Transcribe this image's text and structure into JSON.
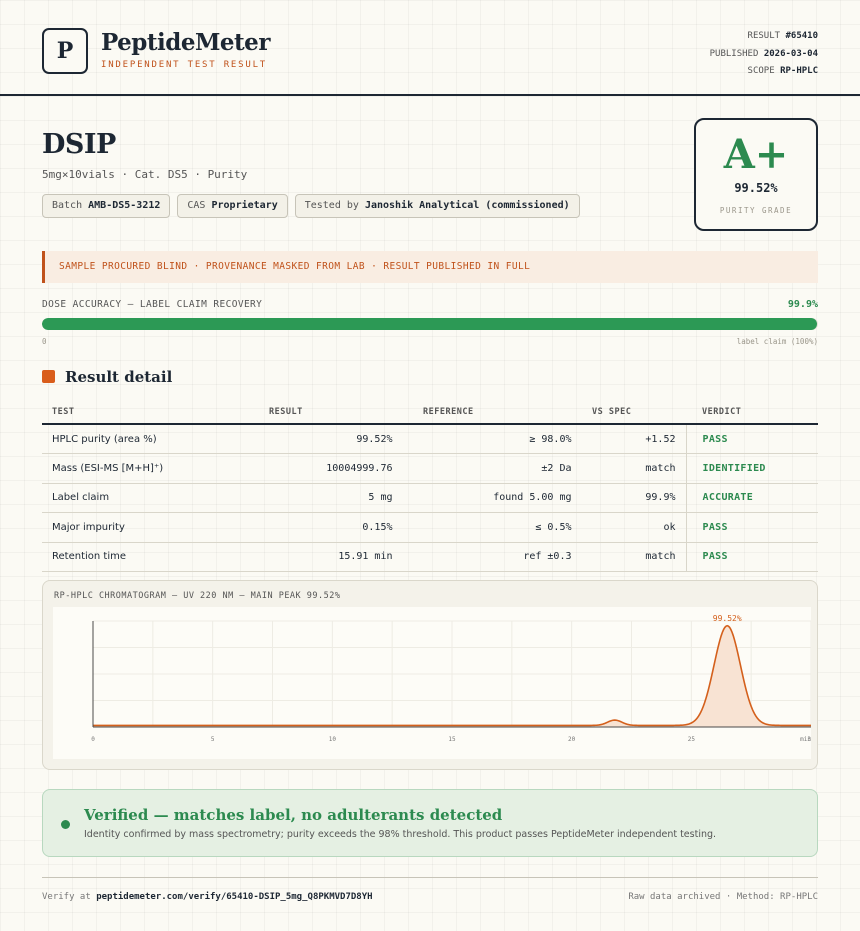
{
  "brand": {
    "logo_letter": "P",
    "name": "PeptideMeter",
    "tagline": "INDEPENDENT TEST RESULT"
  },
  "meta": {
    "result_label": "RESULT",
    "result_value": "#65410",
    "published_label": "PUBLISHED",
    "published_value": "2026-03-04",
    "scope_label": "SCOPE",
    "scope_value": "RP-HPLC"
  },
  "product": {
    "name": "DSIP",
    "subtitle": "5mg×10vials · Cat. DS5 · Purity"
  },
  "chips": {
    "batch_label": "Batch",
    "batch_value": "AMB-DS5-3212",
    "cas_label": "CAS",
    "cas_value": "Proprietary",
    "tested_label": "Tested by",
    "tested_value": "Janoshik Analytical (commissioned)"
  },
  "grade": {
    "letter": "A+",
    "value": "99.52%",
    "label": "PURITY GRADE"
  },
  "notice": "SAMPLE PROCURED BLIND · PROVENANCE MASKED FROM LAB · RESULT PUBLISHED IN FULL",
  "dose": {
    "label": "DOSE ACCURACY — LABEL CLAIM RECOVERY",
    "value": "99.9%",
    "fill_percent": 99.9,
    "min_label": "0",
    "max_label": "label claim (100%)"
  },
  "results": {
    "title": "Result detail",
    "headers": {
      "test": "TEST",
      "result": "RESULT",
      "reference": "REFERENCE",
      "vs_spec": "VS SPEC",
      "verdict": "VERDICT"
    },
    "rows": [
      {
        "test": "HPLC purity (area %)",
        "result": "99.52%",
        "reference": "≥ 98.0%",
        "vs_spec": "+1.52",
        "verdict": "PASS"
      },
      {
        "test": "Mass (ESI-MS [M+H]⁺)",
        "result": "10004999.76",
        "reference": "±2 Da",
        "vs_spec": "match",
        "verdict": "IDENTIFIED"
      },
      {
        "test": "Label claim",
        "result": "5 mg",
        "reference": "found 5.00 mg",
        "vs_spec": "99.9%",
        "verdict": "ACCURATE"
      },
      {
        "test": "Major impurity",
        "result": "0.15%",
        "reference": "≤ 0.5%",
        "vs_spec": "ok",
        "verdict": "PASS"
      },
      {
        "test": "Retention time",
        "result": "15.91 min",
        "reference": "ref ±0.3",
        "vs_spec": "match",
        "verdict": "PASS"
      }
    ]
  },
  "chromatogram": {
    "title": "RP-HPLC CHROMATOGRAM — UV 220 NM — MAIN PEAK 99.52%"
  },
  "chart_data": {
    "type": "line",
    "title": "RP-HPLC CHROMATOGRAM — UV 220 NM — MAIN PEAK 99.52%",
    "xlim": [
      0,
      30
    ],
    "ylim": [
      0,
      100
    ],
    "x_ticks": [
      "0",
      "5",
      "10",
      "15",
      "20",
      "25",
      "30"
    ],
    "x_unit_label": "min",
    "baseline": 1.5,
    "peaks": [
      {
        "center": 21.8,
        "height": 5,
        "width": 0.3,
        "label": ""
      },
      {
        "center": 26.5,
        "height": 94,
        "width": 0.55,
        "label": "99.52%"
      }
    ],
    "line_color": "#d4601c",
    "fill_color": "#f8e3d3"
  },
  "verified": {
    "title": "Verified — matches label, no adulterants detected",
    "description": "Identity confirmed by mass spectrometry; purity exceeds the 98% threshold. This product passes PeptideMeter independent testing."
  },
  "footer": {
    "verify_prefix": "Verify at",
    "verify_url": "peptidemeter.com/verify/65410-DSIP_5mg_Q8PKMVD7D8YH",
    "right_text": "Raw data archived · Method: RP-HPLC"
  }
}
